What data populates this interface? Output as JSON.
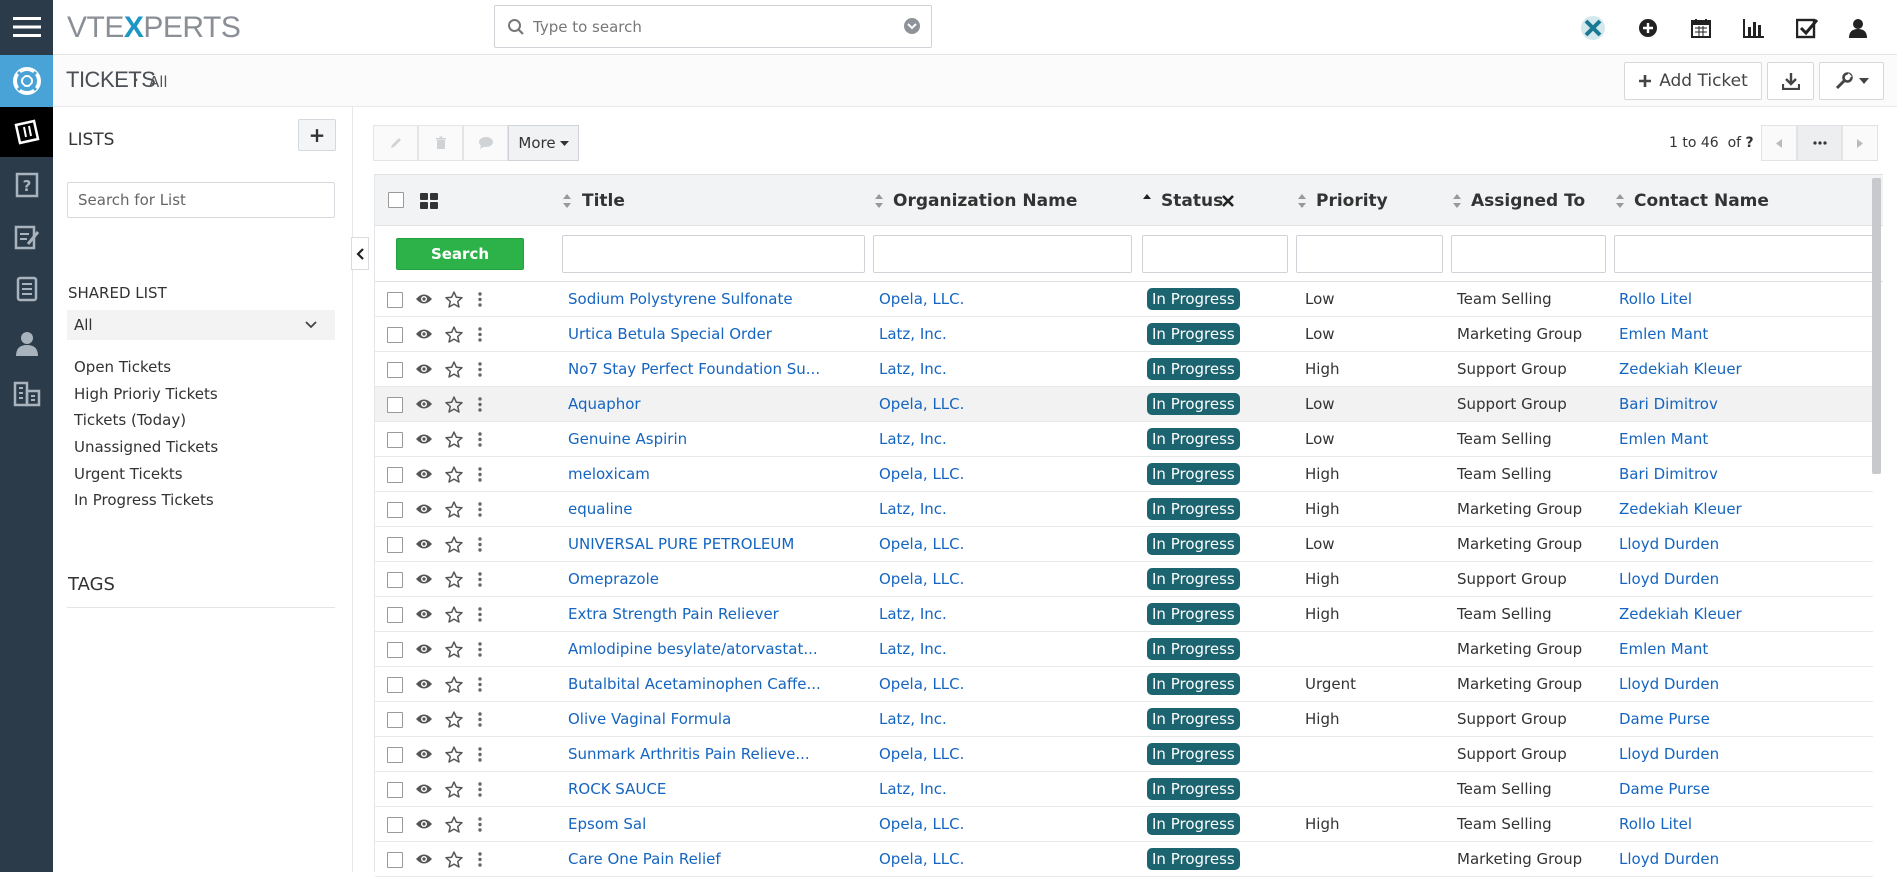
{
  "app": {
    "logo_left": "VTE",
    "logo_x": "X",
    "logo_right": "PERTS"
  },
  "header": {
    "search_placeholder": "Type to search",
    "icons": [
      "vtiger-x-icon",
      "plus-circle-icon",
      "calendar-icon",
      "bar-chart-icon",
      "checkbox-icon",
      "user-icon"
    ]
  },
  "page": {
    "module": "TICKETS",
    "breadcrumb_sep": "›",
    "view": "All",
    "add_ticket_label": "Add Ticket"
  },
  "lists": {
    "title": "LISTS",
    "add_label": "+",
    "search_placeholder": "Search for List",
    "shared_title": "SHARED LIST",
    "selected": "All",
    "items": [
      "Open Tickets",
      "High Prioriy Tickets",
      "Tickets (Today)",
      "Unassigned Tickets",
      "Urgent Ticekts",
      "In Progress Tickets"
    ],
    "tags_title": "TAGS"
  },
  "actions": {
    "more_label": "More",
    "pager_text": "1 to 46",
    "pager_of": "of",
    "pager_total": "?"
  },
  "table": {
    "search_label": "Search",
    "columns": [
      "Title",
      "Organization Name",
      "Status",
      "Priority",
      "Assigned To",
      "Contact Name"
    ],
    "rows": [
      {
        "title": "Sodium Polystyrene Sulfonate",
        "org": "Opela, LLC.",
        "status": "In Progress",
        "priority": "Low",
        "assigned": "Team Selling",
        "contact": "Rollo Litel"
      },
      {
        "title": "Urtica Betula Special Order",
        "org": "Latz, Inc.",
        "status": "In Progress",
        "priority": "Low",
        "assigned": "Marketing Group",
        "contact": "Emlen Mant"
      },
      {
        "title": "No7 Stay Perfect Foundation Su...",
        "org": "Latz, Inc.",
        "status": "In Progress",
        "priority": "High",
        "assigned": "Support Group",
        "contact": "Zedekiah Kleuer"
      },
      {
        "title": "Aquaphor",
        "org": "Opela, LLC.",
        "status": "In Progress",
        "priority": "Low",
        "assigned": "Support Group",
        "contact": "Bari Dimitrov"
      },
      {
        "title": "Genuine Aspirin",
        "org": "Latz, Inc.",
        "status": "In Progress",
        "priority": "Low",
        "assigned": "Team Selling",
        "contact": "Emlen Mant"
      },
      {
        "title": "meloxicam",
        "org": "Opela, LLC.",
        "status": "In Progress",
        "priority": "High",
        "assigned": "Team Selling",
        "contact": "Bari Dimitrov"
      },
      {
        "title": "equaline",
        "org": "Latz, Inc.",
        "status": "In Progress",
        "priority": "High",
        "assigned": "Marketing Group",
        "contact": "Zedekiah Kleuer"
      },
      {
        "title": "UNIVERSAL PURE PETROLEUM",
        "org": "Opela, LLC.",
        "status": "In Progress",
        "priority": "Low",
        "assigned": "Marketing Group",
        "contact": "Lloyd Durden"
      },
      {
        "title": "Omeprazole",
        "org": "Opela, LLC.",
        "status": "In Progress",
        "priority": "High",
        "assigned": "Support Group",
        "contact": "Lloyd Durden"
      },
      {
        "title": "Extra Strength Pain Reliever",
        "org": "Latz, Inc.",
        "status": "In Progress",
        "priority": "High",
        "assigned": "Team Selling",
        "contact": "Zedekiah Kleuer"
      },
      {
        "title": "Amlodipine besylate/atorvastat...",
        "org": "Latz, Inc.",
        "status": "In Progress",
        "priority": "",
        "assigned": "Marketing Group",
        "contact": "Emlen Mant"
      },
      {
        "title": "Butalbital Acetaminophen Caffe...",
        "org": "Opela, LLC.",
        "status": "In Progress",
        "priority": "Urgent",
        "assigned": "Marketing Group",
        "contact": "Lloyd Durden"
      },
      {
        "title": "Olive Vaginal Formula",
        "org": "Latz, Inc.",
        "status": "In Progress",
        "priority": "High",
        "assigned": "Support Group",
        "contact": "Dame Purse"
      },
      {
        "title": "Sunmark Arthritis Pain Relieve...",
        "org": "Opela, LLC.",
        "status": "In Progress",
        "priority": "",
        "assigned": "Support Group",
        "contact": "Lloyd Durden"
      },
      {
        "title": "ROCK SAUCE",
        "org": "Latz, Inc.",
        "status": "In Progress",
        "priority": "",
        "assigned": "Team Selling",
        "contact": "Dame Purse"
      },
      {
        "title": "Epsom Sal",
        "org": "Opela, LLC.",
        "status": "In Progress",
        "priority": "High",
        "assigned": "Team Selling",
        "contact": "Rollo Litel"
      },
      {
        "title": "Care One Pain Relief",
        "org": "Opela, LLC.",
        "status": "In Progress",
        "priority": "",
        "assigned": "Marketing Group",
        "contact": "Lloyd Durden"
      }
    ]
  },
  "colors": {
    "rail": "#2c3b49",
    "accent": "#1d97c4",
    "badge": "#1c6470",
    "link": "#1565c0",
    "search_btn": "#2db24a"
  }
}
